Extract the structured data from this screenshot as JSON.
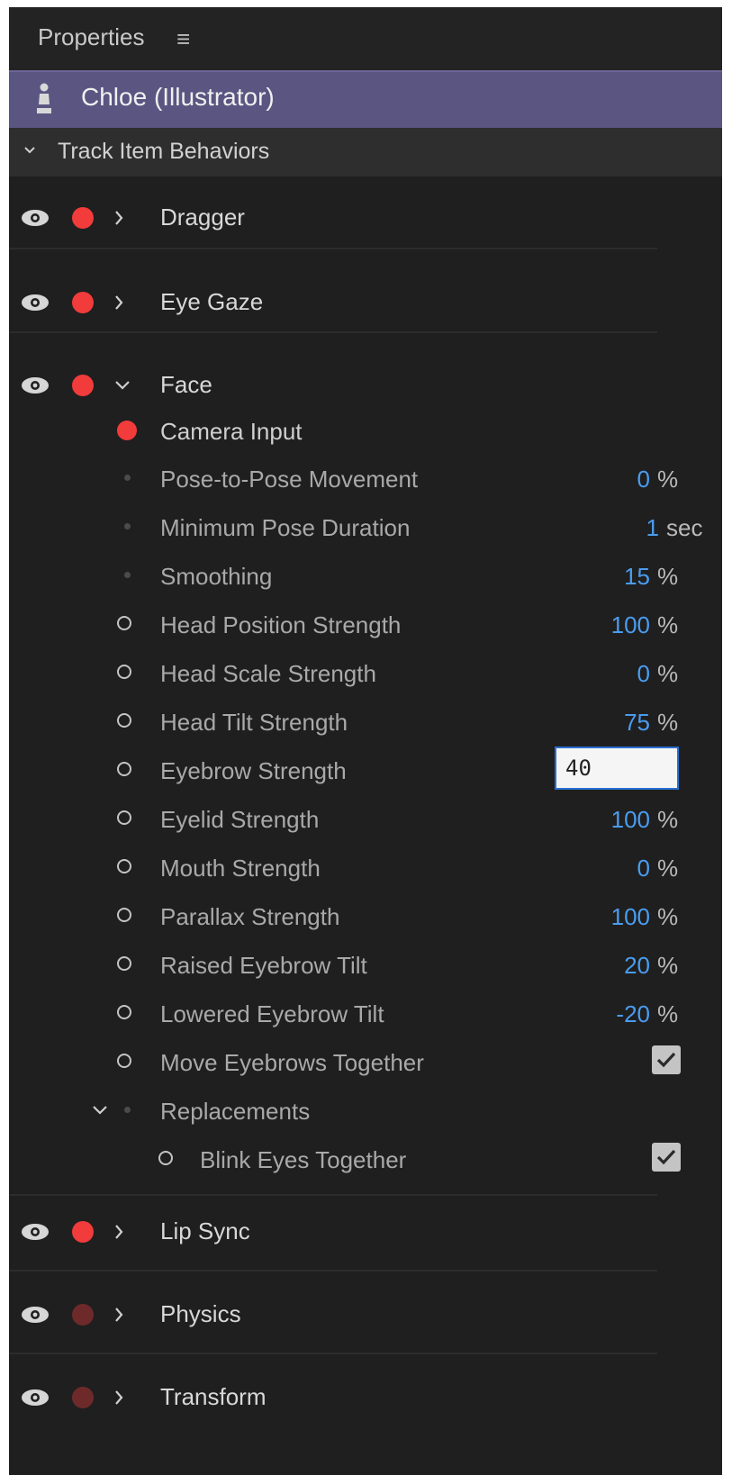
{
  "panel": {
    "title": "Properties",
    "menu_glyph": "≡",
    "puppet_name": "Chloe (Illustrator)",
    "section_label": "Track Item Behaviors"
  },
  "behaviors": {
    "dragger": "Dragger",
    "eye_gaze": "Eye Gaze",
    "face": "Face",
    "lip_sync": "Lip Sync",
    "physics": "Physics",
    "transform": "Transform"
  },
  "face": {
    "camera_input": "Camera Input",
    "params": [
      {
        "label": "Pose-to-Pose Movement",
        "value": "0",
        "unit": "%"
      },
      {
        "label": "Minimum Pose Duration",
        "value": "1",
        "unit": "sec"
      },
      {
        "label": "Smoothing",
        "value": "15",
        "unit": "%"
      },
      {
        "label": "Head Position Strength",
        "value": "100",
        "unit": "%"
      },
      {
        "label": "Head Scale Strength",
        "value": "0",
        "unit": "%"
      },
      {
        "label": "Head Tilt Strength",
        "value": "75",
        "unit": "%"
      },
      {
        "label": "Eyebrow Strength",
        "value": "40",
        "unit": ""
      },
      {
        "label": "Eyelid Strength",
        "value": "100",
        "unit": "%"
      },
      {
        "label": "Mouth Strength",
        "value": "0",
        "unit": "%"
      },
      {
        "label": "Parallax Strength",
        "value": "100",
        "unit": "%"
      },
      {
        "label": "Raised Eyebrow Tilt",
        "value": "20",
        "unit": "%"
      },
      {
        "label": "Lowered Eyebrow Tilt",
        "value": "-20",
        "unit": "%"
      },
      {
        "label": "Move Eyebrows Together",
        "checked": true
      }
    ],
    "replacements": "Replacements",
    "blink": {
      "label": "Blink Eyes Together",
      "checked": true
    }
  },
  "colors": {
    "armed": "#f23b3b",
    "disarmed": "#6e2a2a",
    "puppet_bar": "#5b5582",
    "value_blue": "#4a9cf0"
  }
}
